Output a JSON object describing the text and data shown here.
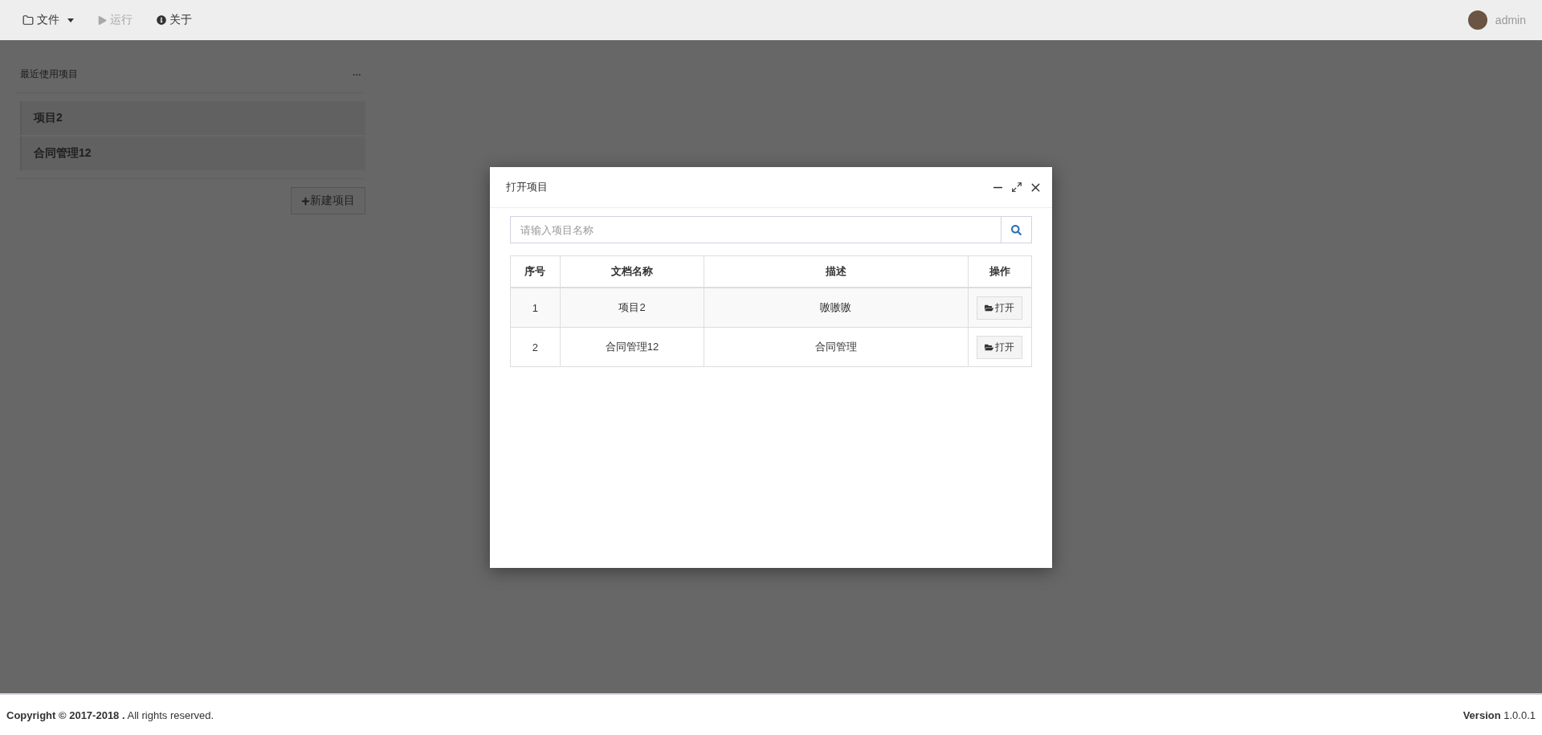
{
  "menu": [
    {
      "label": "文件",
      "dropdown": true,
      "disabled": false
    },
    {
      "label": "运行",
      "dropdown": false,
      "disabled": true
    },
    {
      "label": "关于",
      "dropdown": false,
      "disabled": false
    }
  ],
  "user": {
    "name": "admin"
  },
  "recent": {
    "title": "最近使用项目",
    "more": "···",
    "items": [
      "项目2",
      "合同管理12"
    ],
    "new_button": "新建项目"
  },
  "dialog": {
    "title": "打开项目",
    "search": {
      "placeholder": "请输入项目名称"
    },
    "table": {
      "columns": [
        "序号",
        "文档名称",
        "描述",
        "操作"
      ],
      "rows": [
        {
          "index": "1",
          "name": "项目2",
          "description": "嗷嗷嗷",
          "action": "打开"
        },
        {
          "index": "2",
          "name": "合同管理12",
          "description": "合同管理",
          "action": "打开"
        }
      ]
    }
  },
  "footer": {
    "copyright": "**Copyright © 2017-2018 .** All rights reserved.",
    "version": "**Version** 1.0.0.1"
  }
}
